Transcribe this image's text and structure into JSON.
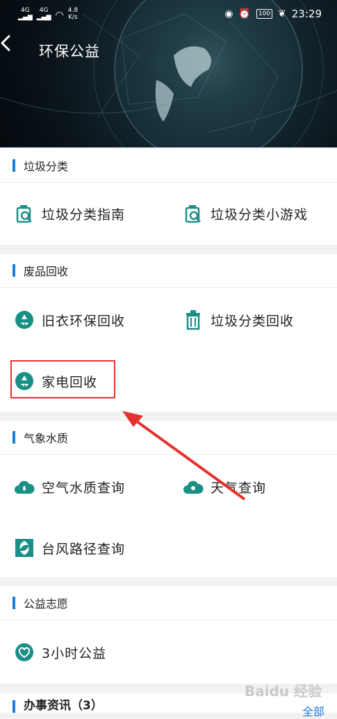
{
  "status_bar": {
    "network_left": "4G",
    "network_right": "4G",
    "speed_value": "4.8",
    "speed_unit": "K/s",
    "battery": "100",
    "time": "23:29"
  },
  "header": {
    "title": "环保公益"
  },
  "sections": [
    {
      "title": "垃圾分类",
      "items": [
        {
          "label": "垃圾分类指南",
          "icon": "garbage-guide-icon"
        },
        {
          "label": "垃圾分类小游戏",
          "icon": "garbage-game-icon"
        }
      ]
    },
    {
      "title": "废品回收",
      "items": [
        {
          "label": "旧衣环保回收",
          "icon": "recycle-icon"
        },
        {
          "label": "垃圾分类回收",
          "icon": "trash-bin-icon"
        },
        {
          "label": "家电回收",
          "icon": "recycle-icon"
        }
      ]
    },
    {
      "title": "气象水质",
      "items": [
        {
          "label": "空气水质查询",
          "icon": "cloud-drop-icon"
        },
        {
          "label": "天气查询",
          "icon": "cloud-sun-icon"
        },
        {
          "label": "台风路径查询",
          "icon": "typhoon-icon"
        }
      ]
    },
    {
      "title": "公益志愿",
      "items": [
        {
          "label": "3小时公益",
          "icon": "heart-hand-icon"
        }
      ]
    },
    {
      "title": "办事资讯（3）"
    }
  ],
  "bottom_link": "全部",
  "watermark": "Baidu 经验",
  "colors": {
    "accent": "#1f7bd8",
    "icon_teal": "#1a8f86",
    "highlight": "#e5312e"
  }
}
